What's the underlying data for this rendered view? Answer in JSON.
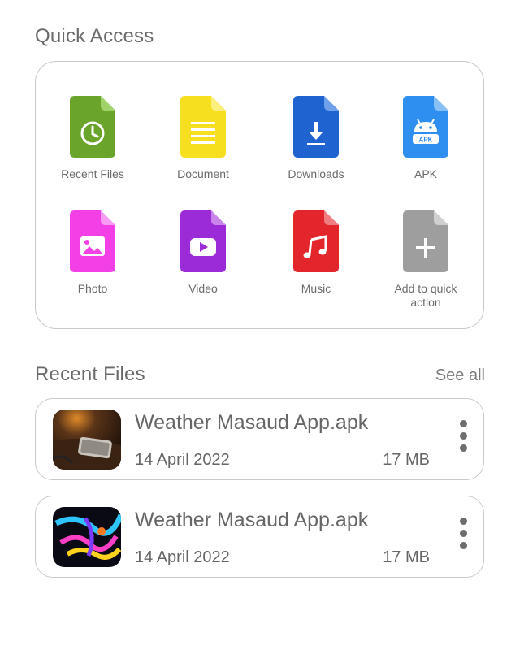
{
  "quick_access": {
    "title": "Quick Access",
    "items": [
      {
        "label": "Recent Files",
        "icon": "clock-icon",
        "color": "#6aa42a"
      },
      {
        "label": "Document",
        "icon": "document-lines-icon",
        "color": "#f5df1e"
      },
      {
        "label": "Downloads",
        "icon": "download-arrow-icon",
        "color": "#1e63cf"
      },
      {
        "label": "APK",
        "icon": "android-icon",
        "color": "#2e8ff0",
        "badge": "APK"
      },
      {
        "label": "Photo",
        "icon": "image-icon",
        "color": "#f23fe6"
      },
      {
        "label": "Video",
        "icon": "play-icon",
        "color": "#9b2bd6"
      },
      {
        "label": "Music",
        "icon": "music-note-icon",
        "color": "#e3262c"
      },
      {
        "label": "Add to quick action",
        "icon": "plus-icon",
        "color": "#9e9e9e"
      }
    ]
  },
  "recent_files": {
    "title": "Recent Files",
    "see_all": "See all",
    "files": [
      {
        "name": "Weather Masaud App.apk",
        "date": "14 April 2022",
        "size": "17 MB",
        "thumbnail": "phone-on-table-photo"
      },
      {
        "name": "Weather Masaud App.apk",
        "date": "14 April 2022",
        "size": "17 MB",
        "thumbnail": "colorful-abstract-photo"
      }
    ]
  }
}
